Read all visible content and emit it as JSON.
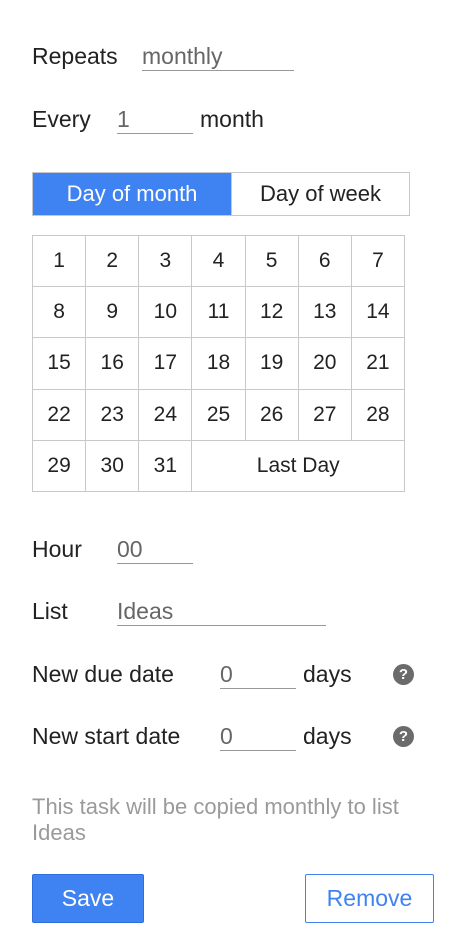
{
  "repeats": {
    "label": "Repeats",
    "value": "monthly"
  },
  "every": {
    "label": "Every",
    "value": "1",
    "unit": "month"
  },
  "mode_tabs": [
    {
      "label": "Day of month",
      "active": true
    },
    {
      "label": "Day of week",
      "active": false
    }
  ],
  "calendar": {
    "days": [
      "1",
      "2",
      "3",
      "4",
      "5",
      "6",
      "7",
      "8",
      "9",
      "10",
      "11",
      "12",
      "13",
      "14",
      "15",
      "16",
      "17",
      "18",
      "19",
      "20",
      "21",
      "22",
      "23",
      "24",
      "25",
      "26",
      "27",
      "28",
      "29",
      "30",
      "31"
    ],
    "last_day_label": "Last Day"
  },
  "hour": {
    "label": "Hour",
    "value": "00"
  },
  "list": {
    "label": "List",
    "value": "Ideas"
  },
  "new_due_date": {
    "label": "New due date",
    "value": "0",
    "unit": "days",
    "help_icon": "question-circle-icon"
  },
  "new_start_date": {
    "label": "New start date",
    "value": "0",
    "unit": "days",
    "help_icon": "question-circle-icon"
  },
  "summary": "This task will be copied monthly to list Ideas",
  "buttons": {
    "save": "Save",
    "remove": "Remove"
  },
  "colors": {
    "accent": "#3f82f2",
    "border": "#c8c8c8",
    "muted_text": "#9a9a9a"
  }
}
